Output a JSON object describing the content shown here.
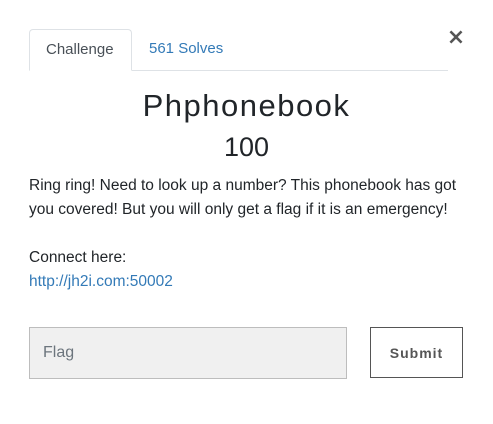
{
  "close": {
    "glyph": "×",
    "icon": "close-icon"
  },
  "tabs": [
    {
      "label": "Challenge",
      "active": true
    },
    {
      "label": "561 Solves",
      "active": false
    }
  ],
  "challenge": {
    "name": "Phphonebook",
    "points": "100",
    "description": "Ring ring! Need to look up a number? This phonebook has got you covered! But you will only get a flag if it is an emergency!",
    "connect_label": "Connect here:",
    "connect_url": "http://jh2i.com:50002"
  },
  "form": {
    "flag_placeholder": "Flag",
    "submit_label": "Submit"
  },
  "colors": {
    "link": "#337ab7",
    "text": "#212529",
    "input_bg": "#f0f0f0"
  }
}
